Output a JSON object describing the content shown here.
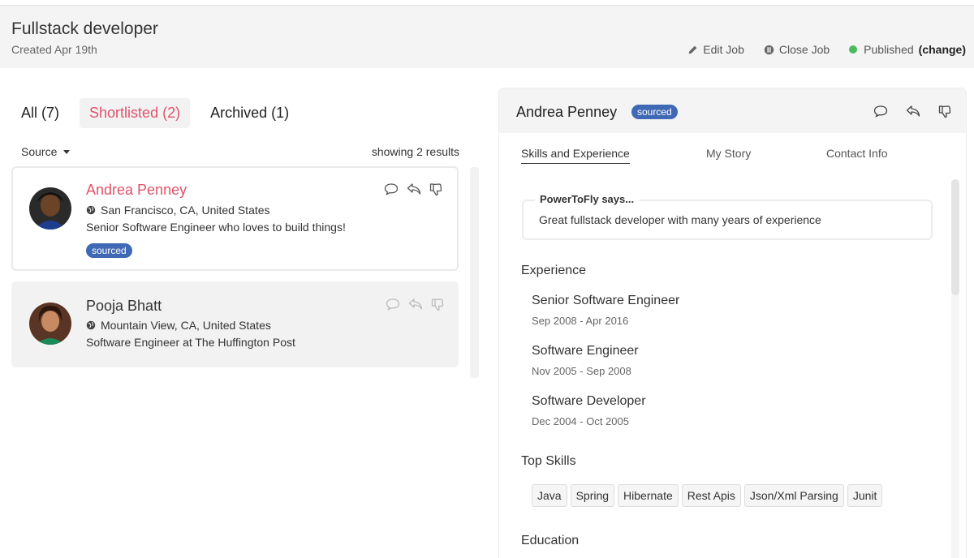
{
  "header": {
    "title": "Fullstack developer",
    "created": "Created Apr 19th",
    "actions": {
      "edit": "Edit Job",
      "close": "Close Job",
      "status": "Published",
      "change": "(change)"
    },
    "status_color": "#4cbb5c"
  },
  "tabs": [
    {
      "label": "All",
      "count": "(7)"
    },
    {
      "label": "Shortlisted",
      "count": "(2)"
    },
    {
      "label": "Archived",
      "count": "(1)"
    }
  ],
  "filter": {
    "source_label": "Source",
    "results": "showing 2 results"
  },
  "candidates": [
    {
      "name": "Andrea Penney",
      "location": "San Francisco, CA, United States",
      "headline": "Senior Software Engineer who loves to build things!",
      "badge": "sourced"
    },
    {
      "name": "Pooja Bhatt",
      "location": "Mountain View, CA, United States",
      "headline": "Software Engineer at The Huffington Post"
    }
  ],
  "detail": {
    "name": "Andrea Penney",
    "badge": "sourced",
    "tabs": [
      "Skills and Experience",
      "My Story",
      "Contact Info"
    ],
    "says_title": "PowerToFly says...",
    "says_text": "Great fullstack developer with many years of experience",
    "experience_title": "Experience",
    "experience": [
      {
        "title": "Senior Software Engineer",
        "dates": "Sep 2008 - Apr 2016"
      },
      {
        "title": "Software Engineer",
        "dates": "Nov 2005 - Sep 2008"
      },
      {
        "title": "Software Developer",
        "dates": "Dec 2004 - Oct 2005"
      }
    ],
    "skills_title": "Top Skills",
    "skills": [
      "Java",
      "Spring",
      "Hibernate",
      "Rest Apis",
      "Json/Xml Parsing",
      "Junit"
    ],
    "education_title": "Education"
  },
  "colors": {
    "accent": "#e0526a",
    "badge": "#3f68b5"
  },
  "icons": [
    "pencil-icon",
    "close-circle-icon",
    "comment-icon",
    "reply-icon",
    "thumbs-down-icon",
    "globe-icon",
    "caret-down-icon"
  ]
}
